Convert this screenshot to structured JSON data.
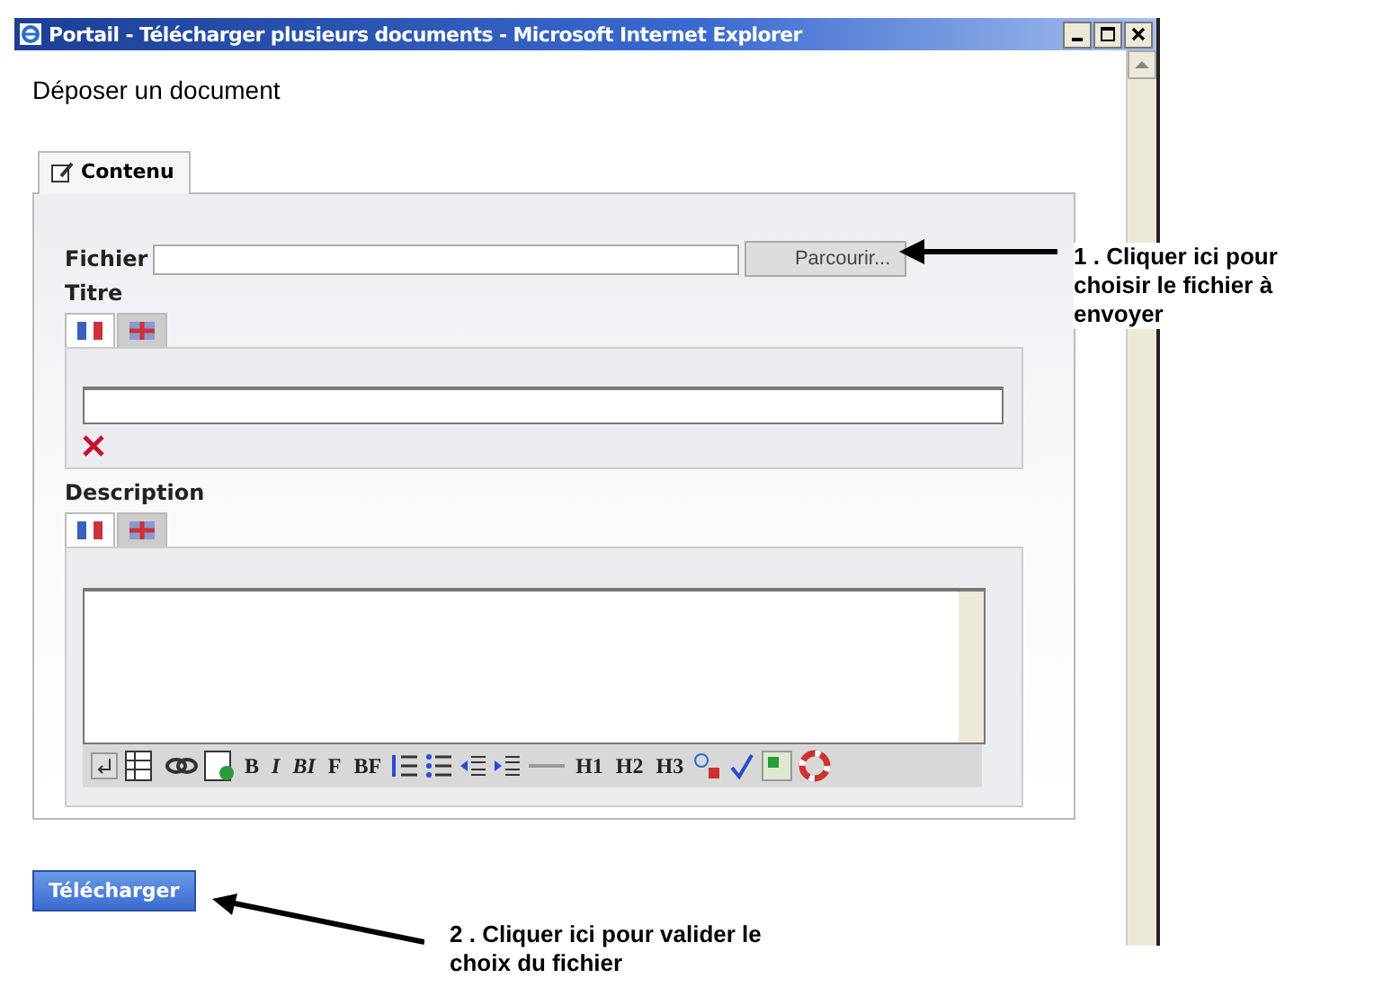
{
  "window": {
    "title": "Portail - Télécharger plusieurs documents - Microsoft Internet Explorer"
  },
  "page_title": "Déposer un document",
  "tabs": [
    {
      "label": "Contenu",
      "selected": true
    }
  ],
  "file_field": {
    "label": "Fichier",
    "browse_button": "Parcourir..."
  },
  "title_field": {
    "label": "Titre",
    "lang_tabs": [
      {
        "selected": true
      },
      {
        "selected": false
      }
    ]
  },
  "description_field": {
    "label": "Description",
    "lang_tabs": [
      {
        "selected": true
      },
      {
        "selected": false
      }
    ]
  },
  "format_buttons": [
    "B",
    "I",
    "BI",
    "F",
    "BF"
  ],
  "heading_buttons": [
    "H1",
    "H2",
    "H3"
  ],
  "submit_button": "Télécharger",
  "annotations": [
    {
      "text": "1 . Cliquer ici pour choisir le fichier à envoyer"
    },
    {
      "text": "2 . Cliquer ici pour valider le choix du fichier"
    }
  ]
}
